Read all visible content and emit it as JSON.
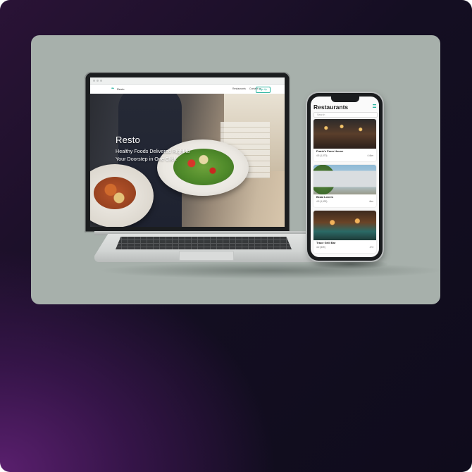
{
  "site": {
    "logo_text": "Resto",
    "nav": [
      "Restaurants",
      "Contact us"
    ],
    "nav_button": "Sign Up",
    "hero_title": "Resto",
    "hero_subtitle": "Healthy Foods Delivered Right to Your Doorstep in One Click"
  },
  "mobile": {
    "title": "Restaurants",
    "search_placeholder": "Search",
    "restaurants": [
      {
        "name": "Frank's Farm House",
        "meta": "4.5 (1,070)",
        "right": "4.4km"
      },
      {
        "name": "Braai Lovers",
        "meta": "4.5 (1,002)",
        "right": "4km"
      },
      {
        "name": "Trace Grill Bar",
        "meta": "4.2 (539)",
        "right": "4+3"
      }
    ]
  },
  "colors": {
    "accent": "#2bb5a0",
    "card_background": "#a7b0ab"
  }
}
